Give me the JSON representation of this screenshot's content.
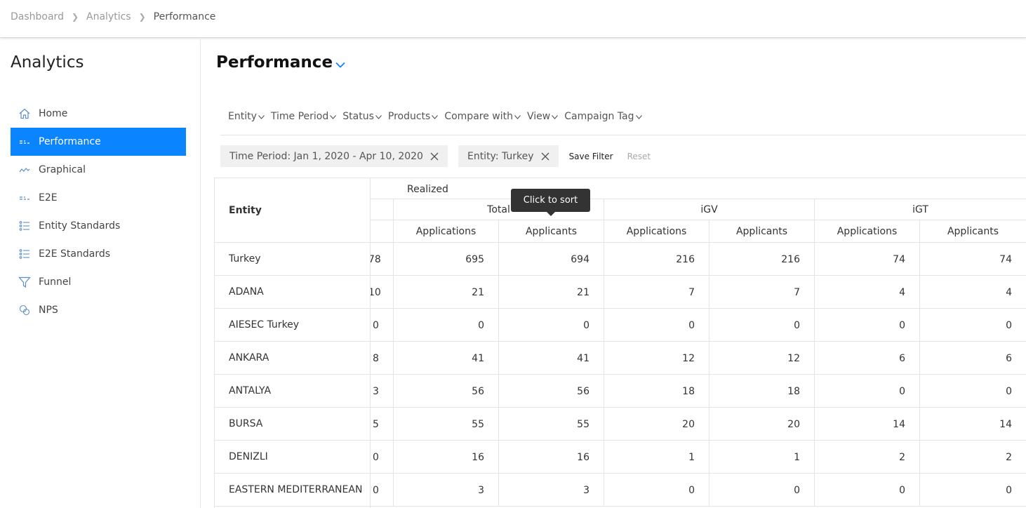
{
  "breadcrumb": [
    "Dashboard",
    "Analytics",
    "Performance"
  ],
  "sidebar": {
    "title": "Analytics",
    "items": [
      {
        "label": "Home",
        "icon": "home-icon"
      },
      {
        "label": "Performance",
        "icon": "performance-icon",
        "active": true
      },
      {
        "label": "Graphical",
        "icon": "graph-icon"
      },
      {
        "label": "E2E",
        "icon": "e2e-icon"
      },
      {
        "label": "Entity Standards",
        "icon": "list-icon"
      },
      {
        "label": "E2E Standards",
        "icon": "list-icon"
      },
      {
        "label": "Funnel",
        "icon": "funnel-icon"
      },
      {
        "label": "NPS",
        "icon": "nps-icon"
      }
    ]
  },
  "page": {
    "title": "Performance"
  },
  "filters": [
    "Entity",
    "Time Period",
    "Status",
    "Products",
    "Compare with",
    "View",
    "Campaign Tag"
  ],
  "chips": [
    {
      "label": "Time Period: Jan 1, 2020 - Apr 10, 2020"
    },
    {
      "label": "Entity: Turkey"
    }
  ],
  "actions": {
    "save_filter": "Save Filter",
    "reset": "Reset"
  },
  "table": {
    "entity_header": "Entity",
    "realized_label": "Realized",
    "groups": [
      "Total",
      "iGV",
      "iGT"
    ],
    "subheaders": [
      "Applications",
      "Applicants",
      "Applications",
      "Applicants",
      "Applications",
      "Applicants"
    ],
    "rows": [
      {
        "entity": "Turkey",
        "cut": "78",
        "values": [
          "695",
          "694",
          "216",
          "216",
          "74",
          "74"
        ]
      },
      {
        "entity": "ADANA",
        "cut": "10",
        "values": [
          "21",
          "21",
          "7",
          "7",
          "4",
          "4"
        ]
      },
      {
        "entity": "AIESEC Turkey",
        "cut": "0",
        "values": [
          "0",
          "0",
          "0",
          "0",
          "0",
          "0"
        ]
      },
      {
        "entity": "ANKARA",
        "cut": "8",
        "values": [
          "41",
          "41",
          "12",
          "12",
          "6",
          "6"
        ]
      },
      {
        "entity": "ANTALYA",
        "cut": "3",
        "values": [
          "56",
          "56",
          "18",
          "18",
          "0",
          "0"
        ]
      },
      {
        "entity": "BURSA",
        "cut": "5",
        "values": [
          "55",
          "55",
          "20",
          "20",
          "14",
          "14"
        ]
      },
      {
        "entity": "DENIZLI",
        "cut": "0",
        "values": [
          "16",
          "16",
          "1",
          "1",
          "2",
          "2"
        ]
      },
      {
        "entity": "EASTERN MEDITERRANEAN",
        "cut": "0",
        "values": [
          "3",
          "3",
          "0",
          "0",
          "0",
          "0"
        ]
      }
    ]
  },
  "tooltip": {
    "text": "Click to sort"
  },
  "colors": {
    "accent": "#0a84ff",
    "tooltip_bg": "#333333"
  }
}
